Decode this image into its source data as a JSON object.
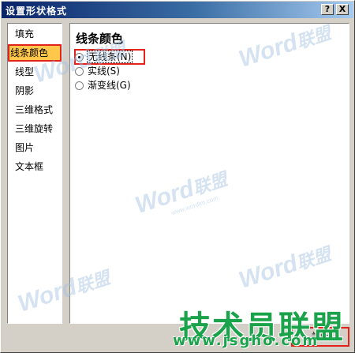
{
  "window": {
    "title": "设置形状格式",
    "help_label": "?",
    "close_label": "X"
  },
  "sidebar": {
    "items": [
      {
        "label": "填充"
      },
      {
        "label": "线条颜色",
        "selected": true
      },
      {
        "label": "线型"
      },
      {
        "label": "阴影"
      },
      {
        "label": "三维格式"
      },
      {
        "label": "三维旋转"
      },
      {
        "label": "图片"
      },
      {
        "label": "文本框"
      }
    ]
  },
  "panel": {
    "title": "线条颜色",
    "options": [
      {
        "label": "无线条(N)",
        "checked": true
      },
      {
        "label": "实线(S)",
        "checked": false
      },
      {
        "label": "渐变线(G)",
        "checked": false
      }
    ]
  },
  "footer": {
    "close_button": "关闭"
  },
  "watermarks": {
    "brand_en": "Word",
    "brand_cn": "联盟",
    "url": "www.wordlm.com"
  },
  "overlay": {
    "logo_text": "技术员联盟",
    "logo_url": "www.jsgho.com"
  },
  "colors": {
    "title_gradient_start": "#0a246a",
    "title_gradient_end": "#a6caf0",
    "selection_fill": "#ffc84a",
    "highlight_border": "#e3221b",
    "logo_green": "#1aa34a",
    "dialog_face": "#d4d0c8"
  }
}
